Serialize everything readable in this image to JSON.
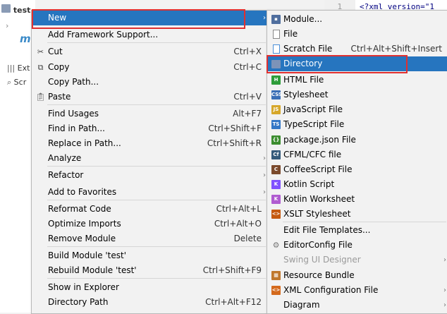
{
  "background": {
    "tree_items": [
      {
        "label": "test"
      },
      {
        "label": "m"
      },
      {
        "label": "Ext"
      },
      {
        "label": "Scr"
      }
    ],
    "editor": {
      "line_number": "1",
      "code": "<?xml version=\"1"
    }
  },
  "main_menu": {
    "items": [
      {
        "label": "New",
        "shortcut": "",
        "icon": "",
        "submenu": true
      },
      {
        "label": "Add Framework Support...",
        "shortcut": "",
        "icon": ""
      },
      {
        "label": "Cut",
        "shortcut": "Ctrl+X",
        "icon": "scissors-icon"
      },
      {
        "label": "Copy",
        "shortcut": "Ctrl+C",
        "icon": "copy-icon"
      },
      {
        "label": "Copy Path...",
        "shortcut": "",
        "icon": ""
      },
      {
        "label": "Paste",
        "shortcut": "Ctrl+V",
        "icon": "paste-icon"
      },
      {
        "label": "Find Usages",
        "shortcut": "Alt+F7",
        "icon": ""
      },
      {
        "label": "Find in Path...",
        "shortcut": "Ctrl+Shift+F",
        "icon": ""
      },
      {
        "label": "Replace in Path...",
        "shortcut": "Ctrl+Shift+R",
        "icon": ""
      },
      {
        "label": "Analyze",
        "shortcut": "",
        "icon": "",
        "submenu": true
      },
      {
        "label": "Refactor",
        "shortcut": "",
        "icon": "",
        "submenu": true
      },
      {
        "label": "Add to Favorites",
        "shortcut": "",
        "icon": "",
        "submenu": true
      },
      {
        "label": "Reformat Code",
        "shortcut": "Ctrl+Alt+L",
        "icon": ""
      },
      {
        "label": "Optimize Imports",
        "shortcut": "Ctrl+Alt+O",
        "icon": ""
      },
      {
        "label": "Remove Module",
        "shortcut": "Delete",
        "icon": ""
      },
      {
        "label": "Build Module 'test'",
        "shortcut": "",
        "icon": ""
      },
      {
        "label": "Rebuild Module 'test'",
        "shortcut": "Ctrl+Shift+F9",
        "icon": ""
      },
      {
        "label": "Show in Explorer",
        "shortcut": "",
        "icon": ""
      },
      {
        "label": "Directory Path",
        "shortcut": "Ctrl+Alt+F12",
        "icon": ""
      }
    ]
  },
  "sub_menu": {
    "items": [
      {
        "label": "Module...",
        "shortcut": "",
        "icon": "module-icon"
      },
      {
        "label": "File",
        "shortcut": "",
        "icon": "file-icon"
      },
      {
        "label": "Scratch File",
        "shortcut": "Ctrl+Alt+Shift+Insert",
        "icon": "scratch-file-icon"
      },
      {
        "label": "Directory",
        "shortcut": "",
        "icon": "folder-icon"
      },
      {
        "label": "HTML File",
        "shortcut": "",
        "icon": "html-file-icon"
      },
      {
        "label": "Stylesheet",
        "shortcut": "",
        "icon": "css-file-icon"
      },
      {
        "label": "JavaScript File",
        "shortcut": "",
        "icon": "javascript-file-icon"
      },
      {
        "label": "TypeScript File",
        "shortcut": "",
        "icon": "typescript-file-icon"
      },
      {
        "label": "package.json File",
        "shortcut": "",
        "icon": "package-json-icon"
      },
      {
        "label": "CFML/CFC file",
        "shortcut": "",
        "icon": "cfml-file-icon"
      },
      {
        "label": "CoffeeScript File",
        "shortcut": "",
        "icon": "coffeescript-file-icon"
      },
      {
        "label": "Kotlin Script",
        "shortcut": "",
        "icon": "kotlin-script-icon"
      },
      {
        "label": "Kotlin Worksheet",
        "shortcut": "",
        "icon": "kotlin-worksheet-icon"
      },
      {
        "label": "XSLT Stylesheet",
        "shortcut": "",
        "icon": "xslt-stylesheet-icon"
      },
      {
        "label": "Edit File Templates...",
        "shortcut": "",
        "icon": ""
      },
      {
        "label": "EditorConfig File",
        "shortcut": "",
        "icon": "gear-icon"
      },
      {
        "label": "Swing UI Designer",
        "shortcut": "",
        "icon": "",
        "submenu": true
      },
      {
        "label": "Resource Bundle",
        "shortcut": "",
        "icon": "resource-bundle-icon"
      },
      {
        "label": "XML Configuration File",
        "shortcut": "",
        "icon": "xml-config-icon",
        "submenu": true
      },
      {
        "label": "Diagram",
        "shortcut": "",
        "icon": "",
        "submenu": true
      }
    ]
  },
  "colors": {
    "selection": "#2675bf",
    "highlight_box": "#e03030",
    "menu_bg": "#f2f2f2"
  }
}
